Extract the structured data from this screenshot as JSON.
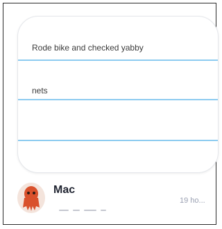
{
  "note": {
    "lines": [
      "Rode bike and checked yabby",
      "nets",
      "",
      ""
    ]
  },
  "author": {
    "name": "Mac",
    "time": "19 ho...",
    "avatar_icon": "red-octopus-avatar-icon"
  },
  "colors": {
    "rule": "#8ccbf0",
    "name": "#1f2330",
    "time": "#9aa0b2",
    "avatar": "#d9512c"
  }
}
